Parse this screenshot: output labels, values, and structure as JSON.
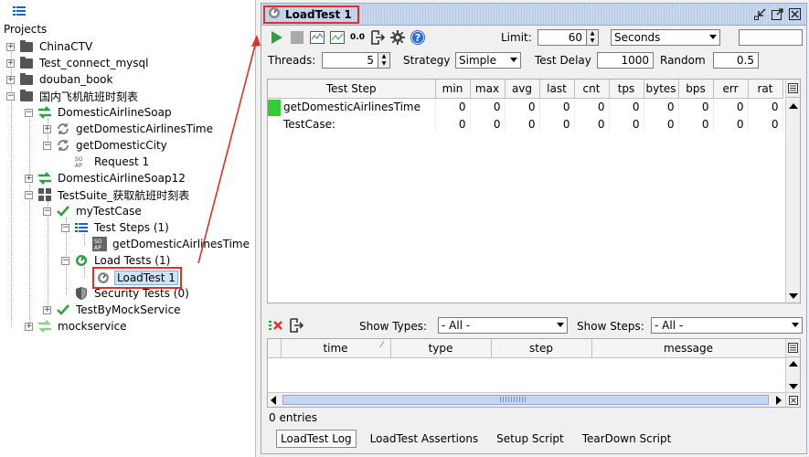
{
  "navigator": {
    "title": "Projects",
    "items": [
      {
        "label": "ChinaCTV"
      },
      {
        "label": "Test_connect_mysql"
      },
      {
        "label": "douban_book"
      },
      {
        "label": "国内飞机航班时刻表"
      },
      {
        "label": "DomesticAirlineSoap"
      },
      {
        "label": "getDomesticAirlinesTime"
      },
      {
        "label": "getDomesticCity"
      },
      {
        "label": "Request 1"
      },
      {
        "label": "DomesticAirlineSoap12"
      },
      {
        "label": "TestSuite_获取航班时刻表"
      },
      {
        "label": "myTestCase"
      },
      {
        "label": "Test Steps (1)"
      },
      {
        "label": "getDomesticAirlinesTime"
      },
      {
        "label": "Load Tests (1)"
      },
      {
        "label": "LoadTest 1"
      },
      {
        "label": "Security Tests (0)"
      },
      {
        "label": "TestByMockService"
      },
      {
        "label": "mockservice"
      }
    ]
  },
  "panel": {
    "title": "LoadTest 1",
    "toolbar": {
      "limit_label": "Limit:",
      "limit_value": "60",
      "limit_unit": "Seconds",
      "threads_label": "Threads:",
      "threads_value": "5",
      "strategy_label": "Strategy",
      "strategy_value": "Simple",
      "test_delay_label": "Test Delay",
      "test_delay_value": "1000",
      "random_label": "Random",
      "random_value": "0.5",
      "zero_zero": "0.0"
    },
    "stats": {
      "columns": [
        "Test Step",
        "min",
        "max",
        "avg",
        "last",
        "cnt",
        "tps",
        "bytes",
        "bps",
        "err",
        "rat"
      ],
      "rows": [
        {
          "name": "getDomesticAirlinesTime",
          "values": [
            "0",
            "0",
            "0",
            "0",
            "0",
            "0",
            "0",
            "0",
            "0",
            "0"
          ]
        },
        {
          "name": "TestCase:",
          "values": [
            "0",
            "0",
            "0",
            "0",
            "0",
            "0",
            "0",
            "0",
            "0",
            "0"
          ]
        }
      ]
    },
    "log": {
      "show_types_label": "Show Types:",
      "show_types_value": "- All -",
      "show_steps_label": "Show Steps:",
      "show_steps_value": "- All -",
      "columns": [
        "time",
        "type",
        "step",
        "message"
      ]
    },
    "entries": "0 entries",
    "tabs": [
      "LoadTest Log",
      "LoadTest Assertions",
      "Setup Script",
      "TearDown Script"
    ]
  },
  "colors": {
    "accent_red": "#e0302c",
    "run_green": "#2ea043",
    "progress_green": "#33cc33"
  }
}
